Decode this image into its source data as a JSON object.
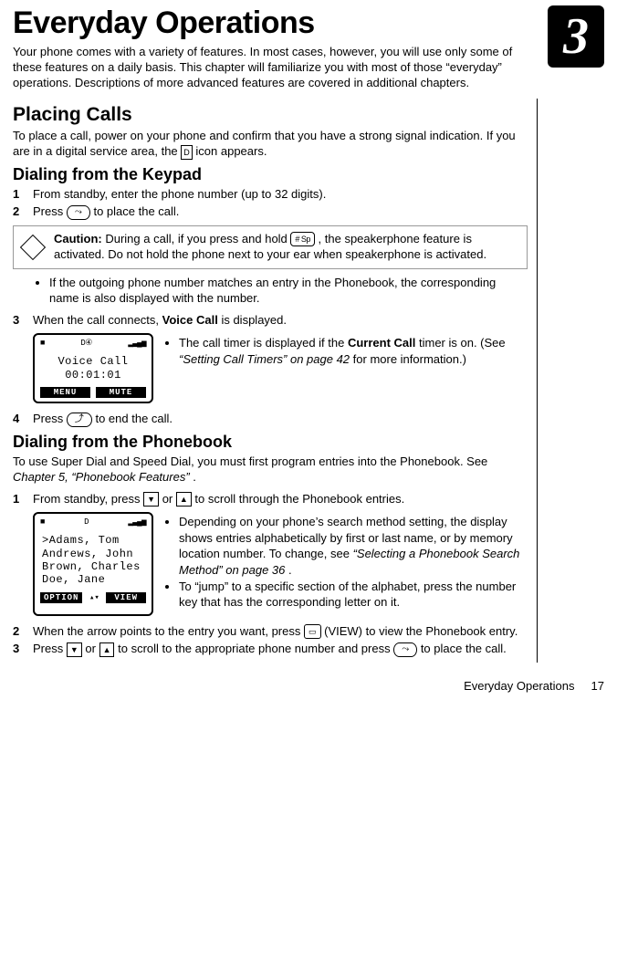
{
  "chapter_number": "3",
  "title": "Everyday Operations",
  "intro": "Your phone comes with a variety of features. In most cases, however, you will use only some of these features on a daily basis. This chapter will familiarize you with most of those “everyday” operations. Descriptions of more advanced features are covered in additional chapters.",
  "placing": {
    "heading": "Placing Calls",
    "body_a": "To place a call, power on your phone and confirm that you have a strong signal indication. If you are in a digital service area, the ",
    "body_b": " icon appears.",
    "signal_icon": "D"
  },
  "keypad": {
    "heading": "Dialing from the Keypad",
    "step1_text": "From standby, enter the phone number (up to 32 digits).",
    "step2_a": "Press ",
    "step2_b": " to place the call.",
    "talk_key": "⤳",
    "caution_a": "Caution:",
    "caution_b": " During a call, if you press and hold ",
    "caution_c": ", the speakerphone feature is activated. Do not hold the phone next to your ear when speakerphone is activated.",
    "hash_key": "# Sp\nQuiet",
    "hash_key_display": "# Sp",
    "bullet1": "If the outgoing phone number matches an entry in the Phonebook, the corresponding name is also displayed with the number.",
    "step3_a": "When the call connects, ",
    "step3_bold": "Voice Call",
    "step3_b": " is displayed.",
    "screen": {
      "status_left": "■",
      "status_mid": "D④",
      "status_right": "▂▃▄▅",
      "line1": "Voice Call",
      "line2": "00:01:01",
      "soft_left": "MENU",
      "soft_right": "MUTE"
    },
    "side_a": "The call timer is displayed if the ",
    "side_bold": "Current Call",
    "side_b": " timer is on. (See ",
    "side_ref": "“Setting Call Timers” on page 42",
    "side_c": " for more information.)",
    "step4_a": "Press ",
    "step4_b": " to end the call.",
    "end_key": "⤴"
  },
  "phonebook": {
    "heading": "Dialing from the Phonebook",
    "intro_a": "To use Super Dial and Speed Dial, you must first program entries into the Phonebook. See ",
    "intro_ref": "Chapter 5, “Phonebook Features”",
    "intro_b": ".",
    "down_key": "▼",
    "up_key": "▲",
    "step1_a": "From standby, press ",
    "step1_or": " or ",
    "step1_b": " to scroll through the Phonebook entries.",
    "screen": {
      "status_left": "■",
      "status_mid": "D",
      "status_right": "▂▃▄▅",
      "line1": ">Adams, Tom",
      "line2": " Andrews, John",
      "line3": " Brown, Charles",
      "line4": " Doe, Jane",
      "soft_left": "OPTION",
      "soft_mid": "▴▾",
      "soft_right": "VIEW"
    },
    "side_b1_a": "Depending on your phone’s search method setting, the display shows entries alphabetically by first or last name, or by memory location number. To change, see ",
    "side_b1_ref": "“Selecting a Phonebook Search Method” on page 36",
    "side_b1_b": ".",
    "side_b2": "To “jump” to a specific section of the alphabet, press the number key that has the corresponding letter on it.",
    "step2_a": "When the arrow points to the entry you want, press ",
    "step2_b": " (VIEW) to view the Phonebook entry.",
    "view_key": "▭",
    "step3_a": "Press ",
    "step3_or": " or ",
    "step3_b": " to scroll to the appropriate phone number and press ",
    "step3_c": " to place the call.",
    "talk_key": "⤳"
  },
  "footer": {
    "title": "Everyday Operations",
    "page": "17"
  }
}
